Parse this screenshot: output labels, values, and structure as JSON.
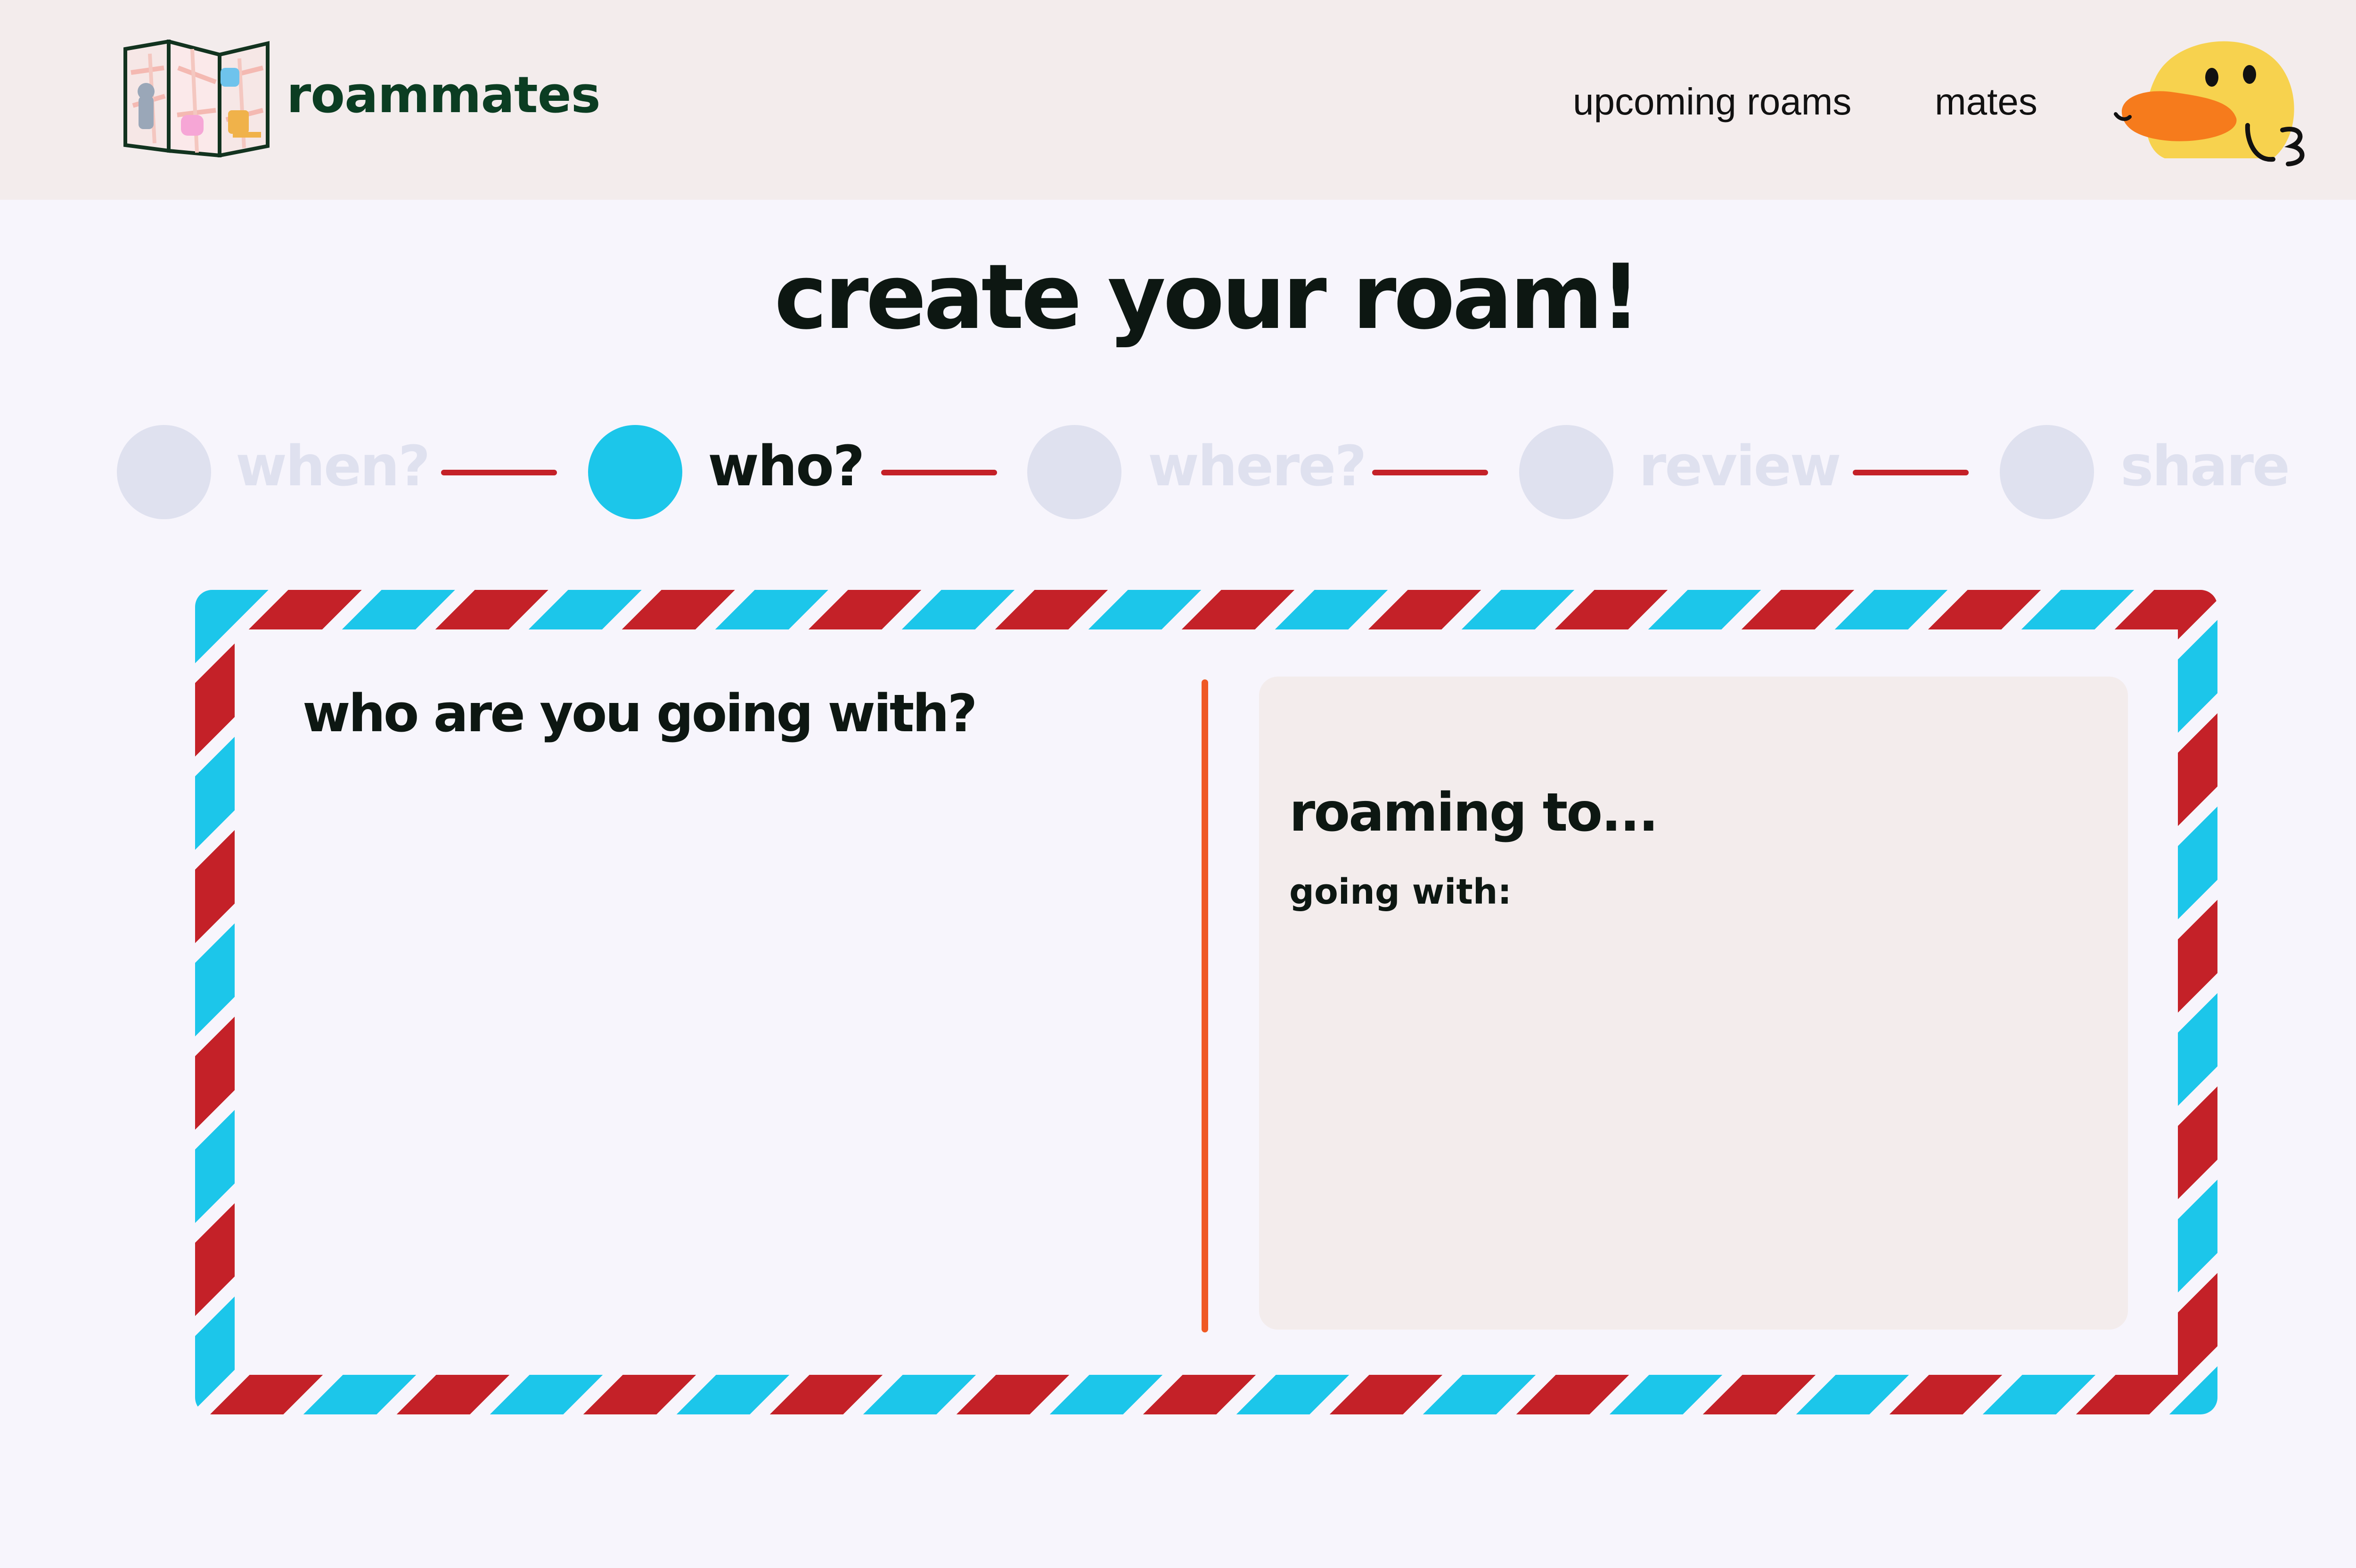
{
  "header": {
    "logo_text": "roammates",
    "nav": [
      {
        "label": "upcoming roams"
      },
      {
        "label": "mates"
      }
    ]
  },
  "page": {
    "title": "create your roam!"
  },
  "stepper": {
    "active_index": 1,
    "steps": [
      {
        "label": "when?"
      },
      {
        "label": "who?"
      },
      {
        "label": "where?"
      },
      {
        "label": "review"
      },
      {
        "label": "share"
      }
    ]
  },
  "form": {
    "left_heading": "who are you going with?",
    "summary": {
      "title": "roaming to...",
      "going_with_label": "going with:"
    }
  },
  "colors": {
    "brand_green": "#0b3d22",
    "accent_blue": "#1cc6ea",
    "accent_red": "#c42128",
    "divider_orange": "#ef5a24",
    "inactive_step": "#dfe1ef",
    "header_bg": "#f3ecec"
  },
  "icons": {
    "logo": "folded-map-icon",
    "avatar": "duck-avatar-icon"
  }
}
